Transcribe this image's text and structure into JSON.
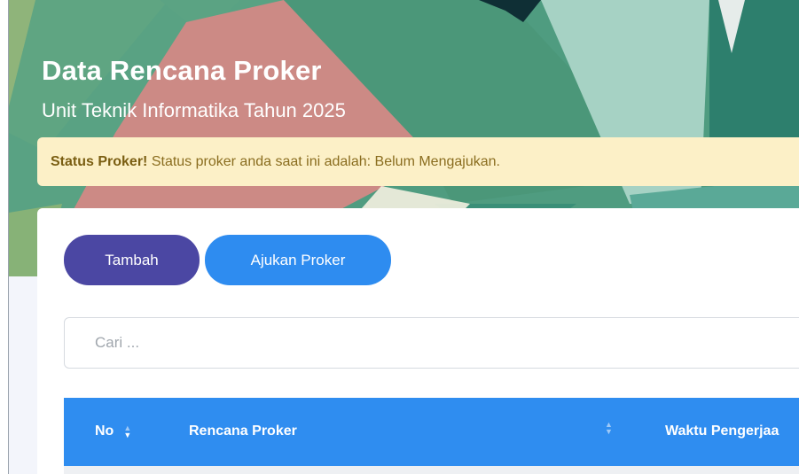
{
  "header": {
    "title": "Data Rencana Proker",
    "subtitle": "Unit Teknik Informatika Tahun 2025"
  },
  "alert": {
    "label": "Status Proker!",
    "message": " Status proker anda saat ini adalah: Belum Mengajukan."
  },
  "actions": {
    "add_label": "Tambah",
    "submit_label": "Ajukan Proker"
  },
  "search": {
    "placeholder": "Cari ..."
  },
  "table": {
    "columns": [
      "No",
      "Rencana Proker",
      "Waktu Pengerjaa"
    ]
  },
  "colors": {
    "primary": "#2f8df0",
    "secondary": "#4b47a3",
    "alert_bg": "#fcf0c7",
    "alert_text": "#8a6d1f"
  }
}
